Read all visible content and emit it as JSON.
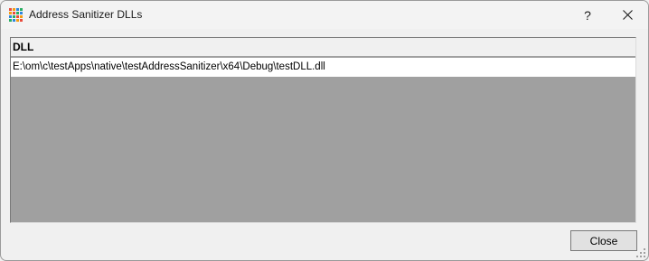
{
  "window": {
    "title": "Address Sanitizer DLLs",
    "help_label": "?"
  },
  "list": {
    "columns": [
      {
        "label": "DLL"
      }
    ],
    "rows": [
      {
        "dll": "E:\\om\\c\\testApps\\native\\testAddressSanitizer\\x64\\Debug\\testDLL.dll"
      }
    ]
  },
  "footer": {
    "close_label": "Close"
  },
  "icons": {
    "app": "grid-app-icon",
    "help": "help-icon",
    "close": "close-icon"
  },
  "colors": {
    "list_background": "#a0a0a0",
    "selected_row": "#ffffff",
    "header": "#f0f0f0"
  }
}
